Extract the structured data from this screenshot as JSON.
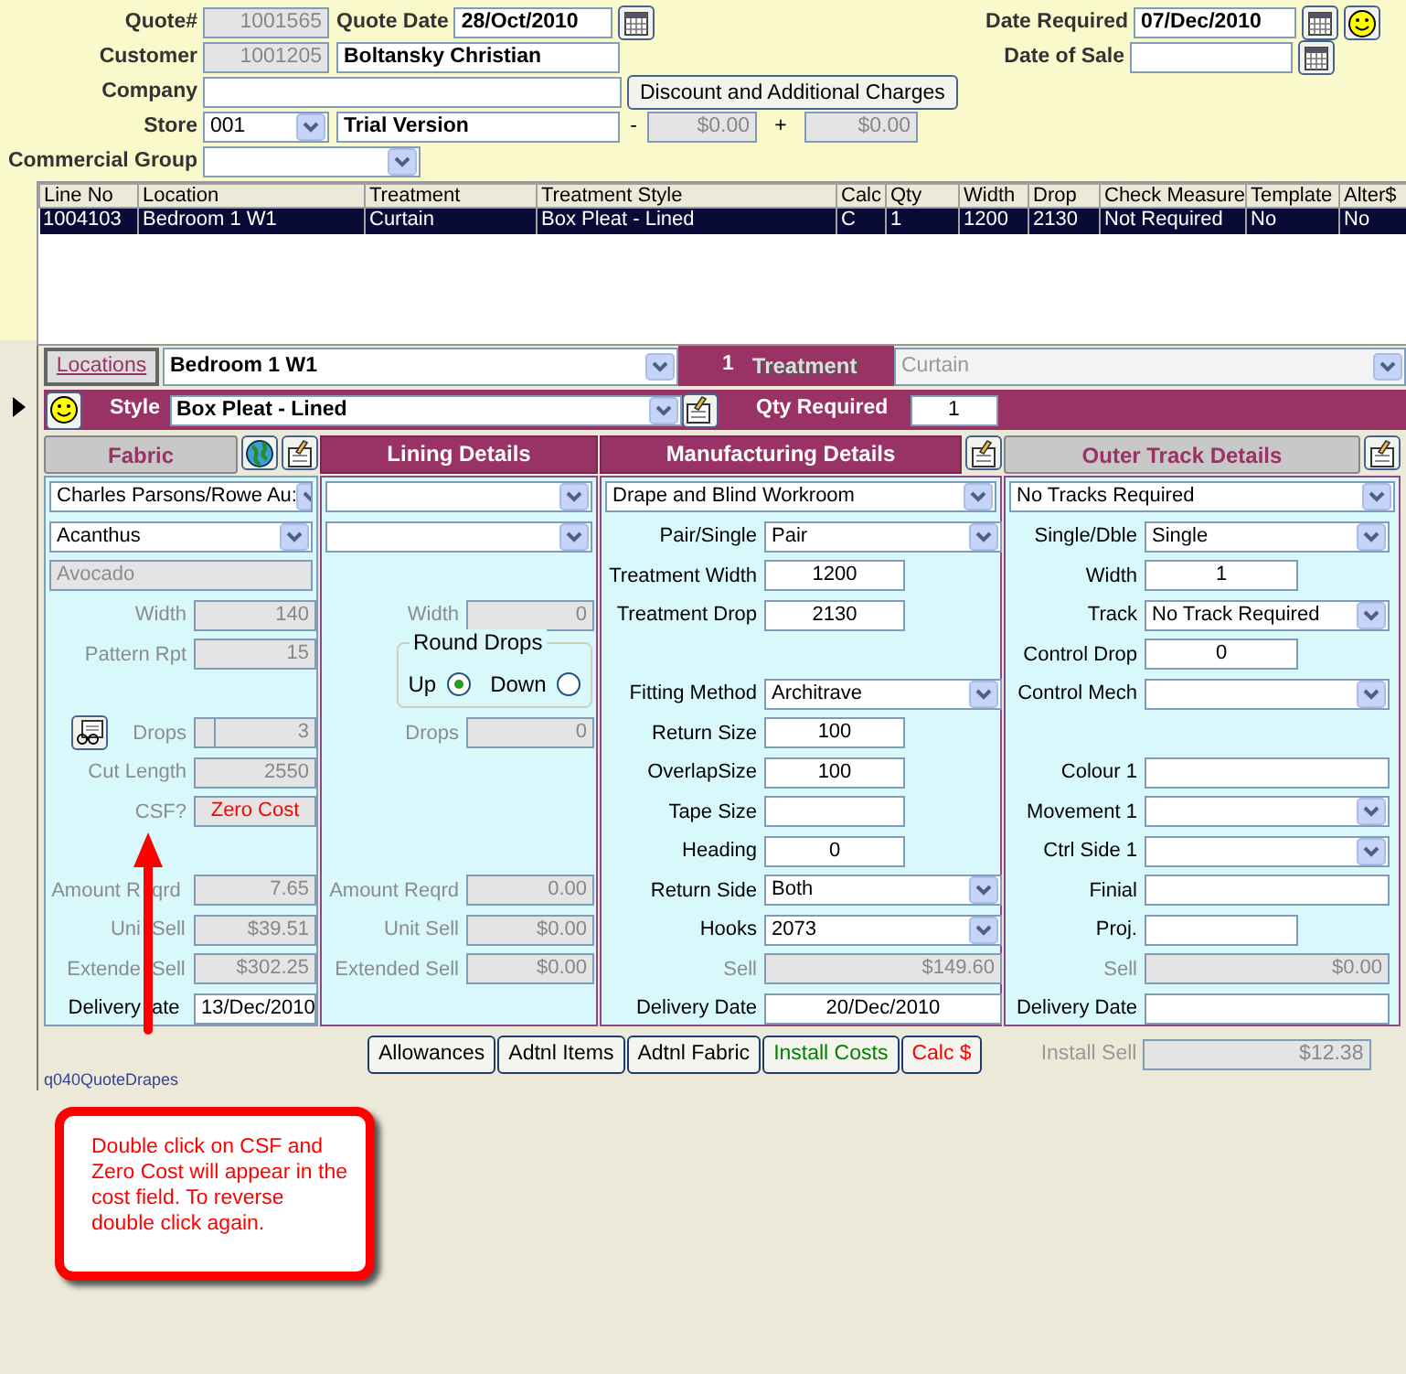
{
  "header": {
    "quote_number": {
      "label": "Quote#",
      "value": "1001565"
    },
    "quote_date": {
      "label": "Quote Date",
      "value": "28/Oct/2010"
    },
    "date_required": {
      "label": "Date Required",
      "value": "07/Dec/2010"
    },
    "customer": {
      "label": "Customer",
      "code": "1001205",
      "name": "Boltansky Christian"
    },
    "date_of_sale": {
      "label": "Date of Sale"
    },
    "company": {
      "label": "Company"
    },
    "discount_button": "Discount and Additional Charges",
    "store": {
      "label": "Store",
      "value": "001",
      "name": "Trial Version",
      "minus": "-",
      "discount": "$0.00",
      "plus": "+",
      "charges": "$0.00"
    },
    "commercial_group": {
      "label": "Commercial Group"
    }
  },
  "lines_table": {
    "columns": [
      "Line No",
      "Location",
      "Treatment",
      "Treatment Style",
      "Calc",
      "Qty",
      "Width",
      "Drop",
      "Check Measure",
      "Template",
      "Alter$"
    ],
    "rows": [
      {
        "selected": true,
        "cells": [
          "1004103",
          "Bedroom 1 W1",
          "Curtain",
          "Box Pleat - Lined",
          "C",
          "1",
          "1200",
          "2130",
          "Not Required",
          "No",
          "No"
        ]
      }
    ]
  },
  "location_bar": {
    "button": "Locations",
    "location": "Bedroom 1 W1",
    "number": "1",
    "treatment_label": "Treatment",
    "treatment": "Curtain"
  },
  "style_bar": {
    "label": "Style",
    "style": "Box Pleat - Lined",
    "qty_label": "Qty Required",
    "qty": "1"
  },
  "panels": [
    {
      "header": {
        "text": "Fabric",
        "kind": "button"
      },
      "icon_buttons": [
        {
          "kind": "globe"
        },
        {
          "kind": "notes"
        }
      ],
      "rows": [
        {
          "kind": "select_wide",
          "value": "Charles Parsons/Rowe Au:"
        },
        {
          "kind": "select_wide",
          "value": "Acanthus"
        },
        {
          "kind": "readonly_wide",
          "value": "Avocado"
        },
        {
          "kind": "readonly",
          "label": "Width",
          "value": "140"
        },
        {
          "kind": "readonly",
          "label": "Pattern Rpt",
          "value": "15"
        },
        {
          "kind": "blank"
        },
        {
          "kind": "readonly_button",
          "label": "Drops",
          "value": "3"
        },
        {
          "kind": "readonly",
          "label": "Cut Length",
          "value": "2550"
        },
        {
          "kind": "readonly",
          "label": "CSF?",
          "value": "Zero Cost",
          "alert": true
        },
        {
          "kind": "blank"
        },
        {
          "kind": "readonly",
          "label_parts": [
            "Amount R",
            "qrd"
          ],
          "value": "7.65"
        },
        {
          "kind": "readonly",
          "label_parts": [
            "Uni",
            "Sell"
          ],
          "value": "$39.51"
        },
        {
          "kind": "readonly",
          "label_parts": [
            "Extende",
            "Sell"
          ],
          "value": "$302.25"
        },
        {
          "kind": "field",
          "label_parts": [
            "Delivery",
            "ate"
          ],
          "value": "13/Dec/2010"
        }
      ]
    },
    {
      "header": {
        "text": "Lining Details",
        "kind": "banner"
      },
      "rows": [
        {
          "kind": "select_wide"
        },
        {
          "kind": "select_wide"
        },
        {
          "kind": "blank"
        },
        {
          "kind": "readonly",
          "label": "Width",
          "value": "0"
        },
        {
          "kind": "radio_group",
          "label": "Round Drops",
          "options": [
            {
              "label": "Up",
              "selected": true
            },
            {
              "label": "Down",
              "selected": false
            }
          ]
        },
        {
          "kind": "readonly",
          "label": "Drops",
          "value": "0"
        },
        {
          "kind": "blank"
        },
        {
          "kind": "blank"
        },
        {
          "kind": "blank"
        },
        {
          "kind": "readonly",
          "label": "Amount Reqrd",
          "value": "0.00"
        },
        {
          "kind": "readonly",
          "label": "Unit Sell",
          "value": "$0.00"
        },
        {
          "kind": "readonly",
          "label": "Extended Sell",
          "value": "$0.00"
        },
        {
          "kind": "blank"
        }
      ]
    },
    {
      "header": {
        "text": "Manufacturing Details",
        "kind": "banner"
      },
      "icon_buttons": [
        {
          "kind": "notes"
        }
      ],
      "rows": [
        {
          "kind": "select_wide",
          "value": "Drape and Blind Workroom"
        },
        {
          "kind": "select",
          "label": "Pair/Single",
          "value": "Pair"
        },
        {
          "kind": "short_field",
          "label": "Treatment Width",
          "value": "1200"
        },
        {
          "kind": "short_field",
          "label": "Treatment Drop",
          "value": "2130"
        },
        {
          "kind": "blank"
        },
        {
          "kind": "select",
          "label": "Fitting Method",
          "value": "Architrave"
        },
        {
          "kind": "short_field",
          "label": "Return Size",
          "value": "100"
        },
        {
          "kind": "short_field",
          "label": "OverlapSize",
          "value": "100"
        },
        {
          "kind": "short_field",
          "label": "Tape Size"
        },
        {
          "kind": "short_field",
          "label": "Heading",
          "value": "0"
        },
        {
          "kind": "select",
          "label": "Return Side",
          "value": "Both"
        },
        {
          "kind": "select",
          "label": "Hooks",
          "value": "2073"
        },
        {
          "kind": "readonly",
          "label": "Sell",
          "value": "$149.60"
        },
        {
          "kind": "field",
          "label": "Delivery Date",
          "value": "20/Dec/2010"
        }
      ]
    },
    {
      "header": {
        "text": "Outer Track Details",
        "kind": "button"
      },
      "icon_buttons": [
        {
          "kind": "notes"
        }
      ],
      "rows": [
        {
          "kind": "select_wide",
          "value": "No Tracks Required"
        },
        {
          "kind": "select",
          "label": "Single/Dble",
          "value": "Single"
        },
        {
          "kind": "short_field",
          "label": "Width",
          "value": "1"
        },
        {
          "kind": "select",
          "label": "Track",
          "value": "No Track Required"
        },
        {
          "kind": "short_field",
          "label": "Control Drop",
          "value": "0"
        },
        {
          "kind": "select",
          "label": "Control Mech"
        },
        {
          "kind": "blank"
        },
        {
          "kind": "field",
          "label": "Colour 1"
        },
        {
          "kind": "select",
          "label": "Movement 1"
        },
        {
          "kind": "select",
          "label": "Ctrl Side 1"
        },
        {
          "kind": "field",
          "label": "Finial"
        },
        {
          "kind": "short_field",
          "label": "Proj."
        },
        {
          "kind": "readonly",
          "label": "Sell",
          "value": "$0.00"
        },
        {
          "kind": "field",
          "label": "Delivery Date"
        }
      ]
    }
  ],
  "form_name": "q040QuoteDrapes",
  "buttons": [
    {
      "label": "Allowances",
      "color": "#000000"
    },
    {
      "label": "Adtnl Items",
      "color": "#000000"
    },
    {
      "label": "Adtnl Fabric",
      "color": "#000000"
    },
    {
      "label": "Install Costs",
      "color": "#008000"
    },
    {
      "label": "Calc $",
      "color": "#ff0000"
    }
  ],
  "install_sell": {
    "label": "Install Sell",
    "value": "$12.38"
  },
  "callout": "Double click on CSF and Zero Cost will appear in the cost field.  To reverse double click again."
}
